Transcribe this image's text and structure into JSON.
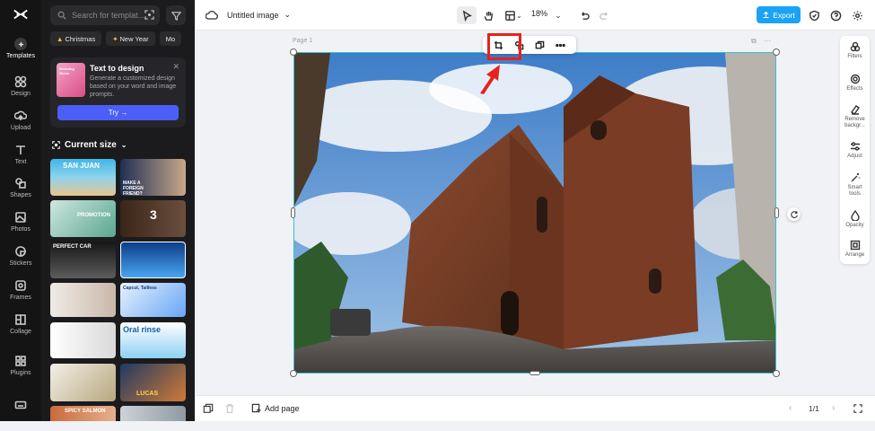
{
  "nav": {
    "items": [
      {
        "label": "Templates",
        "icon": "templates-icon"
      },
      {
        "label": "Design",
        "icon": "design-icon"
      },
      {
        "label": "Upload",
        "icon": "upload-icon"
      },
      {
        "label": "Text",
        "icon": "text-icon"
      },
      {
        "label": "Shapes",
        "icon": "shapes-icon"
      },
      {
        "label": "Photos",
        "icon": "photos-icon"
      },
      {
        "label": "Stickers",
        "icon": "stickers-icon"
      },
      {
        "label": "Frames",
        "icon": "frames-icon"
      },
      {
        "label": "Collage",
        "icon": "collage-icon"
      },
      {
        "label": "Plugins",
        "icon": "plugins-icon"
      }
    ]
  },
  "panel": {
    "search_placeholder": "Search for templat...",
    "chips": [
      "Christmas",
      "New Year",
      "Mo"
    ],
    "text_to_design": {
      "title": "Text to design",
      "description": "Generate a customized design based on your word and image prompts.",
      "try_label": "Try →",
      "thumb_text": "Wedding Gloss"
    },
    "current_size": "Current size",
    "templates": [
      {
        "text": "SAN JUAN"
      },
      {
        "text": "MAKE A FOREIGN FRIEND?"
      },
      {
        "text": "PROMOTION"
      },
      {
        "text": "3"
      },
      {
        "text": "PERFECT CAR"
      },
      {
        "text": ""
      },
      {
        "text": ""
      },
      {
        "text": "Capcut, Tailless"
      },
      {
        "text": ""
      },
      {
        "text": "Oral rinse"
      },
      {
        "text": ""
      },
      {
        "text": "LUCAS"
      },
      {
        "text": "SPICY SALMON"
      },
      {
        "text": ""
      }
    ]
  },
  "topbar": {
    "doc_title": "Untitled image",
    "zoom": "18%",
    "export_label": "Export"
  },
  "canvas": {
    "page_label": "Page 1",
    "context_tools": [
      "crop-icon",
      "mask-icon",
      "duplicate-icon",
      "more-icon"
    ]
  },
  "right_panel": {
    "items": [
      {
        "label": "Filters"
      },
      {
        "label": "Effects"
      },
      {
        "label": "Remove backgr..."
      },
      {
        "label": "Adjust"
      },
      {
        "label": "Smart tools"
      },
      {
        "label": "Opacity"
      },
      {
        "label": "Arrange"
      }
    ]
  },
  "bottombar": {
    "add_page": "Add page",
    "pager": "1/1"
  },
  "colors": {
    "accent": "#1aa3f4",
    "selection": "#2fc2d1",
    "highlight": "#e8211c",
    "try_button": "#4b5ef7"
  }
}
